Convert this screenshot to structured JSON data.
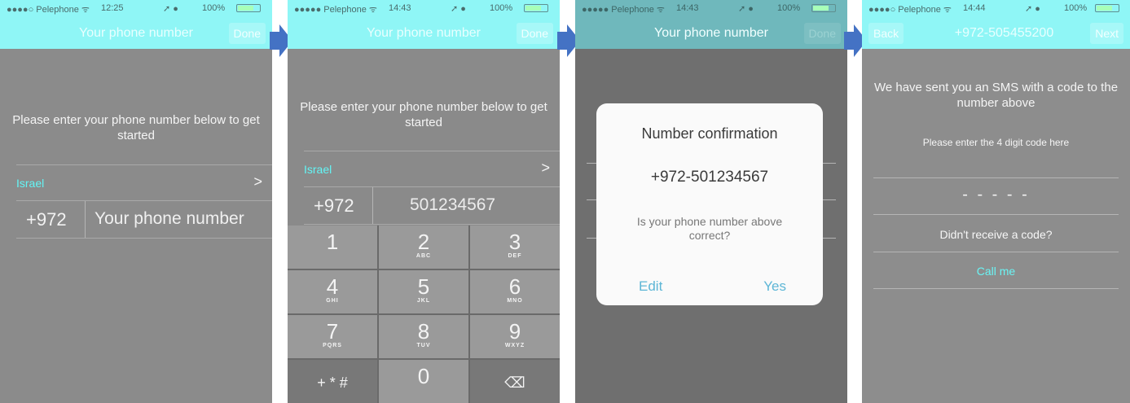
{
  "screens": [
    {
      "status": {
        "carrier": "●●●●○ Pelephone ᯤ",
        "time": "12:25",
        "icons": "➚ ●",
        "battery": "100%"
      },
      "nav": {
        "title": "Your phone number",
        "right": "Done"
      },
      "prompt": "Please enter your phone number below to get started",
      "country": "Israel",
      "chevron": ">",
      "dial_code": "+972",
      "phone_placeholder": "Your phone number"
    },
    {
      "status": {
        "carrier": "●●●●● Pelephone ᯤ",
        "time": "14:43",
        "icons": "➚ ●",
        "battery": "100%"
      },
      "nav": {
        "title": "Your phone number",
        "right": "Done"
      },
      "prompt": "Please enter your phone number below to get started",
      "country": "Israel",
      "chevron": ">",
      "dial_code": "+972",
      "phone_value": "501234567",
      "keys": [
        {
          "d": "1",
          "l": ""
        },
        {
          "d": "2",
          "l": "ABC"
        },
        {
          "d": "3",
          "l": "DEF"
        },
        {
          "d": "4",
          "l": "GHI"
        },
        {
          "d": "5",
          "l": "JKL"
        },
        {
          "d": "6",
          "l": "MNO"
        },
        {
          "d": "7",
          "l": "PQRS"
        },
        {
          "d": "8",
          "l": "TUV"
        },
        {
          "d": "9",
          "l": "WXYZ"
        },
        {
          "d": "+ * #",
          "l": ""
        },
        {
          "d": "0",
          "l": ""
        },
        {
          "d": "⌫",
          "l": ""
        }
      ]
    },
    {
      "status": {
        "carrier": "●●●●● Pelephone ᯤ",
        "time": "14:43",
        "icons": "➚ ●",
        "battery": "100%"
      },
      "nav": {
        "title": "Your phone number",
        "right": "Done"
      },
      "dialog": {
        "title": "Number confirmation",
        "number": "+972-501234567",
        "question": "Is your phone number above correct?",
        "edit": "Edit",
        "yes": "Yes"
      }
    },
    {
      "status": {
        "carrier": "●●●●○ Pelephone ᯤ",
        "time": "14:44",
        "icons": "➚ ●",
        "battery": "100%"
      },
      "nav": {
        "title": "+972-505455200",
        "left": "Back",
        "right": "Next"
      },
      "prompt": "We have sent you an SMS with a code to the number above",
      "code_hint": "Please enter the 4 digit code here",
      "code_placeholder": "- - - - -",
      "resend": "Didn't receive a code?",
      "call": "Call me"
    }
  ],
  "colors": {
    "accent": "#8ff6f6",
    "link": "#63f5f5",
    "arrow": "#4472c4"
  }
}
